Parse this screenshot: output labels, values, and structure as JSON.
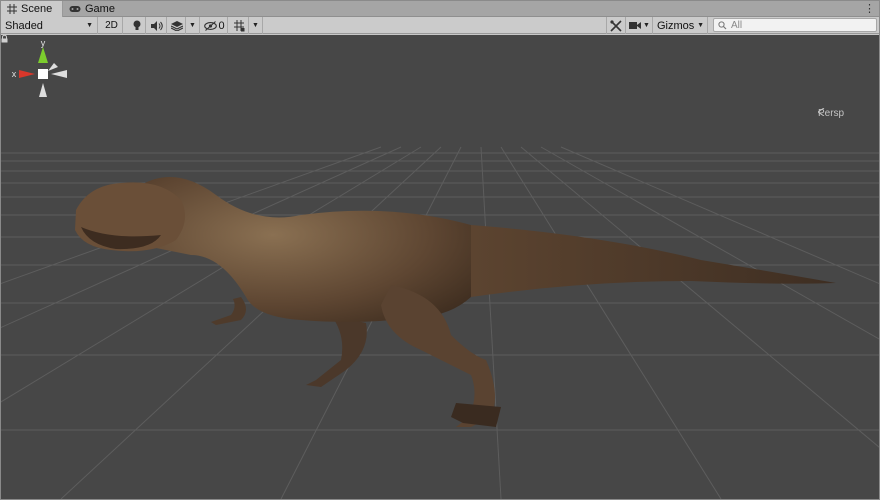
{
  "tabs": [
    {
      "label": "Scene",
      "icon": "grid-icon",
      "active": true
    },
    {
      "label": "Game",
      "icon": "gamepad-icon",
      "active": false
    }
  ],
  "tab_menu": "⋮",
  "toolbar": {
    "shading_mode": "Shaded",
    "btn_2d": "2D",
    "hidden_count": "0",
    "gizmos_label": "Gizmos",
    "search_placeholder": "All"
  },
  "viewport": {
    "projection_label": "Persp",
    "axes": {
      "x": "x",
      "y": "y"
    },
    "colors": {
      "background": "#474747",
      "grid": "#5a5a5a",
      "x_axis": "#d9372b",
      "y_axis": "#7ccc2d"
    },
    "model": "tyrannosaurus"
  }
}
